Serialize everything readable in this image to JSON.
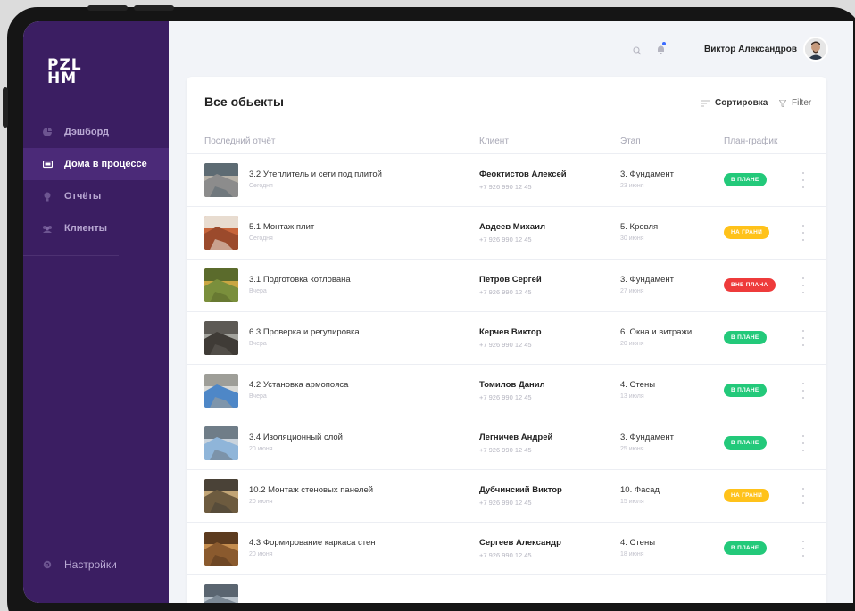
{
  "app": {
    "logo_line1": "PZL",
    "logo_line2": "HM"
  },
  "sidebar": {
    "items": [
      {
        "label": "Дэшборд",
        "icon": "pie-chart-icon",
        "active": false
      },
      {
        "label": "Дома в процессе",
        "icon": "monitor-icon",
        "active": true
      },
      {
        "label": "Отчёты",
        "icon": "bulb-icon",
        "active": false
      },
      {
        "label": "Клиенты",
        "icon": "users-icon",
        "active": false
      }
    ],
    "settings_label": "Настройки"
  },
  "header": {
    "user_name": "Виктор Александров"
  },
  "objects": {
    "title": "Все обьекты",
    "sort_label": "Сортировка",
    "filter_label": "Filter",
    "columns": {
      "report": "Последний отчёт",
      "client": "Клиент",
      "stage": "Этап",
      "plan": "План-график"
    },
    "rows": [
      {
        "report": "3.2 Утеплитель и сети под плитой",
        "report_date": "Сегодня",
        "client": "Феоктистов Алексей",
        "phone": "+7 926 990 12 45",
        "stage": "3. Фундамент",
        "stage_date": "23 июня",
        "status": "В ПЛАНЕ",
        "status_color": "#23c97a",
        "thumb": [
          "#8c8c8c",
          "#b7b2a8",
          "#5d6b73"
        ]
      },
      {
        "report": "5.1 Монтаж плит",
        "report_date": "Сегодня",
        "client": "Авдеев Михаил",
        "phone": "+7 926 990 12 45",
        "stage": "5. Кровля",
        "stage_date": "30 июня",
        "status": "НА ГРАНИ",
        "status_color": "#ffc21a",
        "thumb": [
          "#9b4a2c",
          "#c7643a",
          "#e8dcd0"
        ]
      },
      {
        "report": "3.1 Подготовка котлована",
        "report_date": "Вчера",
        "client": "Петров Сергей",
        "phone": "+7 926 990 12 45",
        "stage": "3. Фундамент",
        "stage_date": "27 июня",
        "status": "ВНЕ ПЛАНА",
        "status_color": "#ee3b3b",
        "thumb": [
          "#7a8f3c",
          "#c9a642",
          "#5b6b2c"
        ]
      },
      {
        "report": "6.3 Проверка и регулировка",
        "report_date": "Вчера",
        "client": "Керчев Виктор",
        "phone": "+7 926 990 12 45",
        "stage": "6. Окна и витражи",
        "stage_date": "20 июня",
        "status": "В ПЛАНЕ",
        "status_color": "#23c97a",
        "thumb": [
          "#3f3b36",
          "#a3a39d",
          "#5d5a55"
        ]
      },
      {
        "report": "4.2 Установка армопояса",
        "report_date": "Вчера",
        "client": "Томилов Данил",
        "phone": "+7 926 990 12 45",
        "stage": "4. Стены",
        "stage_date": "13 июля",
        "status": "В ПЛАНЕ",
        "status_color": "#23c97a",
        "thumb": [
          "#4e87c7",
          "#d8d8d4",
          "#9e9e98"
        ]
      },
      {
        "report": "3.4 Изоляционный слой",
        "report_date": "20 июня",
        "client": "Легничев Андрей",
        "phone": "+7 926 990 12 45",
        "stage": "3. Фундамент",
        "stage_date": "25 июня",
        "status": "В ПЛАНЕ",
        "status_color": "#23c97a",
        "thumb": [
          "#8fb5d9",
          "#c9d3dc",
          "#6f7d88"
        ]
      },
      {
        "report": "10.2 Монтаж стеновых панелей",
        "report_date": "20 июня",
        "client": "Дубчинский Виктор",
        "phone": "+7 926 990 12 45",
        "stage": "10. Фасад",
        "stage_date": "15 июля",
        "status": "НА ГРАНИ",
        "status_color": "#ffc21a",
        "thumb": [
          "#6d5b3f",
          "#c2a576",
          "#4a4237"
        ]
      },
      {
        "report": "4.3 Формирование каркаса стен",
        "report_date": "20 июня",
        "client": "Сергеев Александр",
        "phone": "+7 926 990 12 45",
        "stage": "4. Стены",
        "stage_date": "18 июня",
        "status": "В ПЛАНЕ",
        "status_color": "#23c97a",
        "thumb": [
          "#8a5a2e",
          "#c48d4f",
          "#5c3b1f"
        ]
      },
      {
        "report": "",
        "report_date": "",
        "client": "",
        "phone": "",
        "stage": "",
        "stage_date": "",
        "status": "",
        "status_color": "",
        "thumb": [
          "#7d8a96",
          "#b8c2cb",
          "#5a6570"
        ]
      }
    ]
  }
}
